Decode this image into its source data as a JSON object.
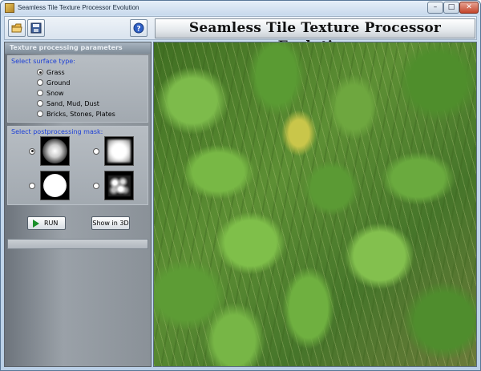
{
  "window": {
    "title": "Seamless Tile Texture Processor Evolution",
    "controls": {
      "minimize": "–",
      "maximize": "□",
      "close": "✕"
    }
  },
  "toolbar": {
    "banner": "Seamless Tile Texture Processor Evolution",
    "icons": [
      "open-folder-icon",
      "save-disk-icon",
      "help-icon"
    ]
  },
  "panel": {
    "header": "Texture processing parameters",
    "surface": {
      "label": "Select surface type:",
      "options": [
        "Grass",
        "Ground",
        "Snow",
        "Sand, Mud, Dust",
        "Bricks, Stones, Plates"
      ],
      "selected_index": 0
    },
    "mask": {
      "label": "Select postprocessing mask:",
      "selected_index": 0
    },
    "run_label": "RUN",
    "show3d_label": "Show in 3D",
    "progress": 0
  },
  "preview": {
    "content": "grass texture image"
  },
  "colors": {
    "group_label": "#1c3fd6",
    "run_icon": "#1a8f2a"
  }
}
